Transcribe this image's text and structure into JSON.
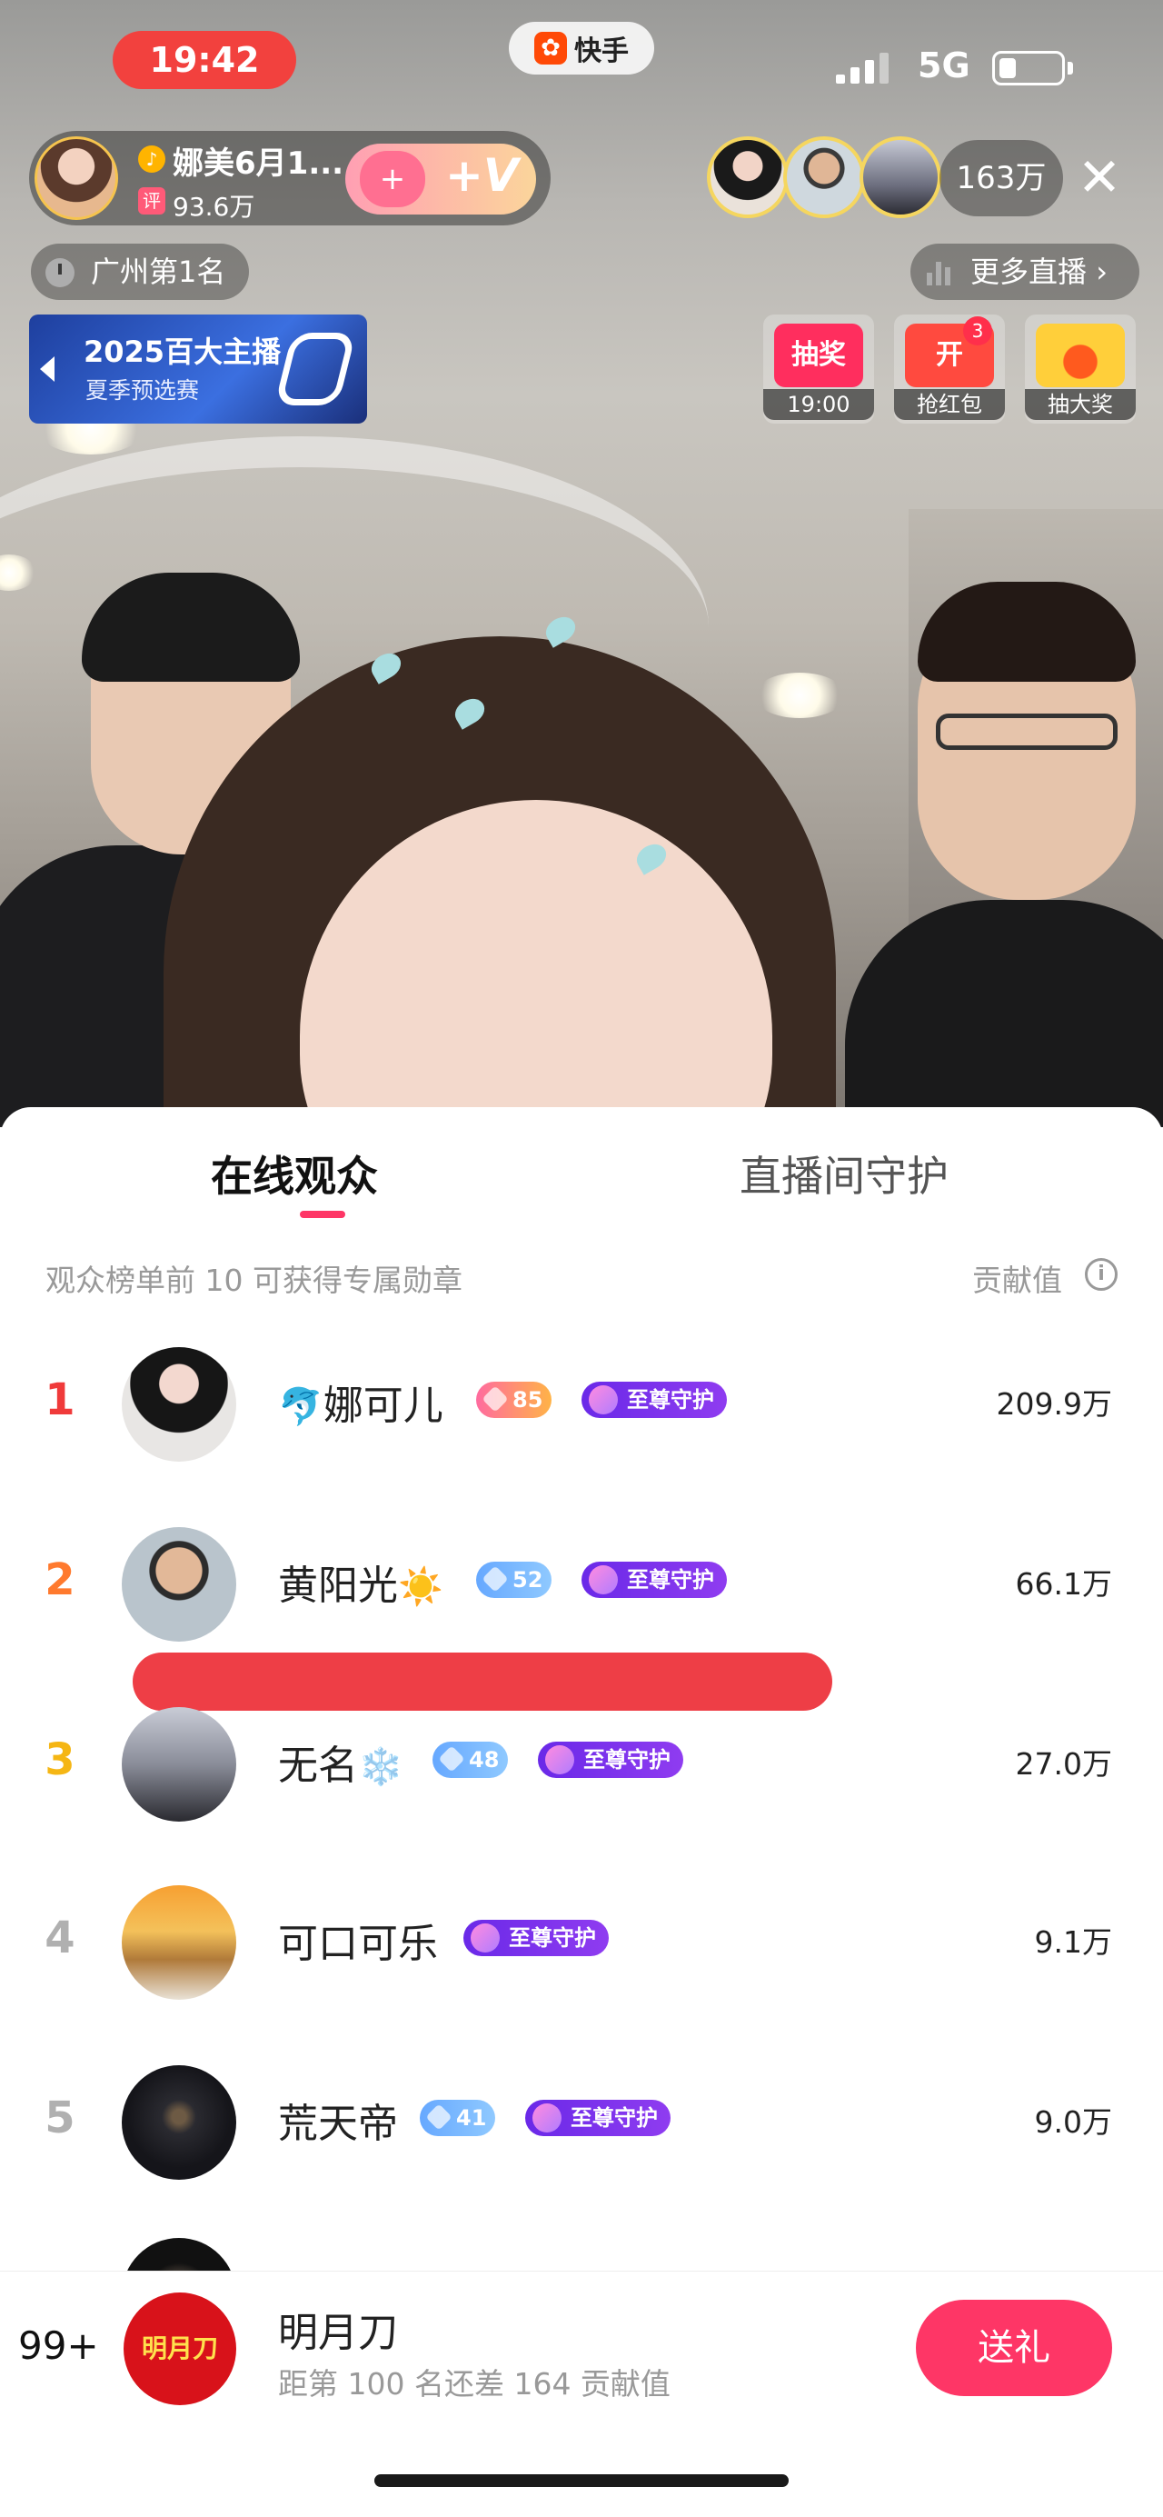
{
  "status_bar": {
    "time": "19:42",
    "app_name": "快手",
    "network": "5G"
  },
  "host": {
    "name": "娜美6月1...",
    "likes": "93.6万",
    "tag": "评"
  },
  "viewer_count": "163万",
  "local_rank": "广州第1名",
  "more_live": "更多直播",
  "contest": {
    "title": "2025百大主播",
    "subtitle": "夏季预选赛"
  },
  "widgets": [
    {
      "icon_text": "抽奖",
      "label": "19:00",
      "color": "#ff2e5e"
    },
    {
      "icon_text": "开",
      "label": "抢红包",
      "color": "#ff4a3f",
      "badge": "3"
    },
    {
      "icon_text": "",
      "label": "抽大奖",
      "color": "#ffb52e"
    }
  ],
  "sheet": {
    "tabs": [
      "在线观众",
      "直播间守护"
    ],
    "hint": "观众榜单前 10 可获得专属勋章",
    "contrib_label": "贡献值"
  },
  "viewers": [
    {
      "rank": "1",
      "name": "娜可儿",
      "prefix": "🐬",
      "suffix": "",
      "level": "85",
      "level_style": "pink",
      "guard": "至尊守护",
      "value": "209.9万",
      "rank_color": "#f03a3a"
    },
    {
      "rank": "2",
      "name": "黄阳光",
      "prefix": "",
      "suffix": "☀️",
      "level": "52",
      "level_style": "blue",
      "guard": "至尊守护",
      "value": "66.1万",
      "rank_color": "#ff7a2e"
    },
    {
      "rank": "3",
      "name": "无名",
      "prefix": "",
      "suffix": "❄️",
      "level": "48",
      "level_style": "blue",
      "guard": "至尊守护",
      "value": "27.0万",
      "rank_color": "#f5b614"
    },
    {
      "rank": "4",
      "name": "可口可乐",
      "prefix": "",
      "suffix": "",
      "level": "",
      "level_style": "",
      "guard": "至尊守护",
      "value": "9.1万",
      "rank_color": "#b0b0b0"
    },
    {
      "rank": "5",
      "name": "荒天帝",
      "prefix": "",
      "suffix": "",
      "level": "41",
      "level_style": "blue",
      "guard": "至尊守护",
      "value": "9.0万",
      "rank_color": "#b0b0b0"
    }
  ],
  "me": {
    "rank": "99+",
    "avatar_text": "明月刀",
    "name": "明月刀",
    "gap_text": "距第 100 名还差 164 贡献值"
  },
  "gift_button": "送礼"
}
